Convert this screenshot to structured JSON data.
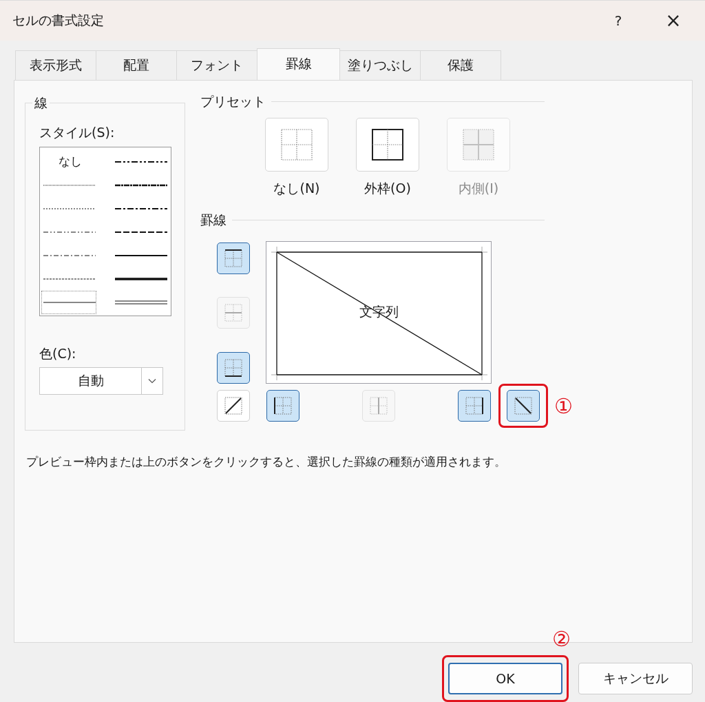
{
  "window": {
    "title": "セルの書式設定",
    "help": "?",
    "close": "×"
  },
  "tabs": [
    {
      "label": "表示形式",
      "selected": false
    },
    {
      "label": "配置",
      "selected": false
    },
    {
      "label": "フォント",
      "selected": false
    },
    {
      "label": "罫線",
      "selected": true
    },
    {
      "label": "塗りつぶし",
      "selected": false
    },
    {
      "label": "保護",
      "selected": false
    }
  ],
  "line_group": {
    "title": "線",
    "style_label": "スタイル(S):",
    "color_label": "色(C):",
    "color_value": "自動",
    "styles": [
      {
        "kind": "none",
        "label": "なし",
        "selected": false
      },
      {
        "kind": "hair",
        "selected": false
      },
      {
        "kind": "dotted",
        "selected": false
      },
      {
        "kind": "dash-dot-dot",
        "selected": false
      },
      {
        "kind": "dash-dot",
        "selected": false
      },
      {
        "kind": "dashed",
        "selected": false
      },
      {
        "kind": "thin",
        "selected": true
      },
      {
        "kind": "medium-dash-dot-dot",
        "selected": false
      },
      {
        "kind": "slant-dash-dot",
        "selected": false
      },
      {
        "kind": "medium-dash-dot",
        "selected": false
      },
      {
        "kind": "medium-dashed",
        "selected": false
      },
      {
        "kind": "medium",
        "selected": false
      },
      {
        "kind": "thick",
        "selected": false
      },
      {
        "kind": "double",
        "selected": false
      }
    ]
  },
  "presets": {
    "title": "プリセット",
    "items": [
      {
        "kind": "none",
        "label": "なし(N)",
        "disabled": false
      },
      {
        "kind": "outline",
        "label": "外枠(O)",
        "disabled": false
      },
      {
        "kind": "inside",
        "label": "内側(I)",
        "disabled": true
      }
    ]
  },
  "border": {
    "title": "罫線",
    "preview_text": "文字列",
    "buttons": [
      {
        "kind": "top",
        "on": true,
        "disabled": false,
        "highlighted": false
      },
      {
        "kind": "h-middle",
        "on": false,
        "disabled": true,
        "highlighted": false
      },
      {
        "kind": "bottom",
        "on": true,
        "disabled": false,
        "highlighted": false
      },
      {
        "kind": "diagonal-up",
        "on": false,
        "disabled": false,
        "highlighted": false
      },
      {
        "kind": "left",
        "on": true,
        "disabled": false,
        "highlighted": false
      },
      {
        "kind": "v-middle",
        "on": false,
        "disabled": true,
        "highlighted": false
      },
      {
        "kind": "right",
        "on": true,
        "disabled": false,
        "highlighted": false
      },
      {
        "kind": "diagonal-down",
        "on": true,
        "disabled": false,
        "highlighted": true,
        "step": "①"
      }
    ]
  },
  "hint": "プレビュー枠内または上のボタンをクリックすると、選択した罫線の種類が適用されます。",
  "buttons": [
    {
      "label": "OK",
      "default": true,
      "highlighted": true,
      "step": "②"
    },
    {
      "label": "キャンセル",
      "default": false,
      "highlighted": false
    }
  ]
}
